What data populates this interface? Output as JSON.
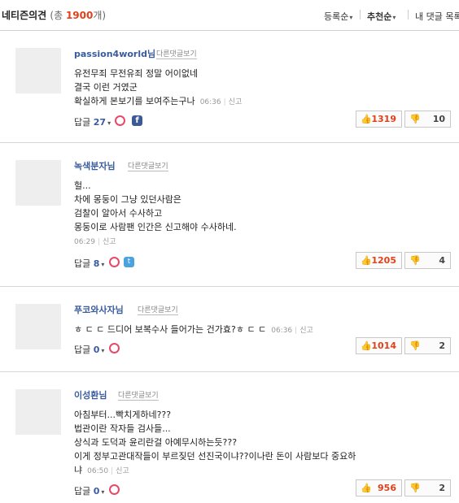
{
  "header": {
    "title": "네티즌의견",
    "count_prefix": "(총 ",
    "count": "1900",
    "count_suffix": "개)",
    "sort_registered": "등록순",
    "sort_recommended": "추천순",
    "my_comments": "내 댓글 목록"
  },
  "labels": {
    "other_comments": "다른댓글보기",
    "reply": "답글",
    "report": "신고",
    "up_icon": "👍",
    "down_icon": "👎",
    "facebook_icon": "f",
    "twitter_icon": "t"
  },
  "comments": [
    {
      "name": "passion4world님",
      "lines": [
        "유전무죄 무전유죄 정말 어이없네",
        "결국 이런 거였군",
        "확실하게 본보기를 보여주는구나"
      ],
      "time": "06:36",
      "reply_count": "27",
      "share": "facebook-icon",
      "up": "1319",
      "down": "10"
    },
    {
      "name": "녹색분자님",
      "lines": [
        "헐...",
        "차에 몽둥이 그냥 있던사람은",
        "검찰이 알아서 수사하고",
        "몽둥이로 사람팬 인간은 신고해야 수사하네."
      ],
      "time": "06:29",
      "reply_count": "8",
      "share": "twitter-icon",
      "up": "1205",
      "down": "4"
    },
    {
      "name": "푸코와사자님",
      "lines": [
        "ㅎ ㄷ ㄷ 드디어 보복수사 들어가는 건가효?ㅎ ㄷ ㄷ"
      ],
      "time": "06:36",
      "reply_count": "0",
      "share": "",
      "up": "1014",
      "down": "2"
    },
    {
      "name": "이성환님",
      "lines": [
        "아침부터...빡치게하네???",
        "법관이란 작자들 검사들...",
        "상식과 도덕과 윤리란걸 아예무시하는듯???",
        "이게 정부고관대작들이 부르짖던 선진국이냐??이나란 돈이 사람보다 중요하",
        "냐"
      ],
      "time": "06:50",
      "reply_count": "0",
      "share": "",
      "up": "956",
      "down": "2"
    }
  ]
}
